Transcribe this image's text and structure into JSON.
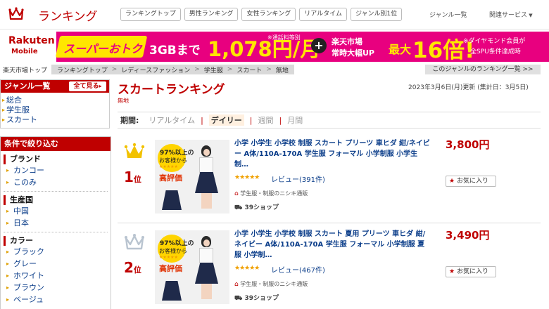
{
  "header": {
    "title": "ランキング",
    "tabs": [
      "ランキングトップ",
      "男性ランキング",
      "女性ランキング",
      "リアルタイム",
      "ジャンル別1位"
    ],
    "genre_list": "ジャンル一覧",
    "related": "関連サービス"
  },
  "banner": {
    "brand": "Rakuten",
    "brand_sub": "Mobile",
    "campaign": "スーパーおトク",
    "plan": "3GBまで",
    "price": "1,078円/月",
    "price_note": "※通話料等別",
    "market1": "楽天市場",
    "market2": "常時大幅UP",
    "max": "最大",
    "multiplier": "16倍!",
    "note_line1": "※ダイヤモンド会員が",
    "note_line2": "全SPU条件達成時"
  },
  "breadcrumb": {
    "items": [
      "楽天市場トップ",
      "ランキングトップ",
      "レディースファッション",
      "学生服",
      "スカート",
      "無地"
    ],
    "genre_link": "このジャンルのランキング一覧 >>"
  },
  "sidebar": {
    "genre_title": "ジャンル一覧",
    "show_all": "全て見る",
    "genres": [
      "総合",
      "学生服",
      "スカート"
    ],
    "filter_title": "条件で絞り込む",
    "groups": [
      {
        "title": "ブランド",
        "items": [
          "カンコー",
          "このみ"
        ]
      },
      {
        "title": "生産国",
        "items": [
          "中国",
          "日本"
        ]
      },
      {
        "title": "カラー",
        "items": [
          "ブラック",
          "グレー",
          "ホワイト",
          "ブラウン",
          "ベージュ"
        ]
      }
    ]
  },
  "main": {
    "title": "スカートランキング",
    "subtitle": "無地",
    "updated": "2023年3月6日(月)更新 (集計日：3月5日)",
    "period_label": "期間:",
    "periods": [
      "リアルタイム",
      "デイリー",
      "週間",
      "月間"
    ],
    "active_period": "デイリー"
  },
  "items": [
    {
      "rank": "1",
      "rank_suffix": "位",
      "title": "小学 小学生 小学校 制服 スカート プリーツ 車ヒダ 紺/ネイビー A体/110A-170A 学生服 フォーマル 小学制服 小学生制…",
      "stars": "★★★★★",
      "reviews": "レビュー(391件)",
      "shop": "学生服・制服のニシキ通販",
      "shipping": "39ショップ",
      "price": "3,800円",
      "favorite": "お気に入り",
      "badge_line1": "97%以上の",
      "badge_line2": "お客様から",
      "badge_stars": "★★★★★",
      "badge_big": "高評価",
      "crown_color": "#f2c200"
    },
    {
      "rank": "2",
      "rank_suffix": "位",
      "title": "小学 小学生 小学校 制服 スカート 夏用 プリーツ 車ヒダ 紺/ネイビー A体/110A-170A 学生服 フォーマル 小学制服 夏服 小学制…",
      "stars": "★★★★★",
      "reviews": "レビュー(467件)",
      "shop": "学生服・制服のニシキ通販",
      "shipping": "39ショップ",
      "price": "3,490円",
      "favorite": "お気に入り",
      "badge_line1": "97%以上の",
      "badge_line2": "お客様から",
      "badge_stars": "★★★★★",
      "badge_big": "高評価",
      "crown_color": "#b9c4d0"
    }
  ]
}
